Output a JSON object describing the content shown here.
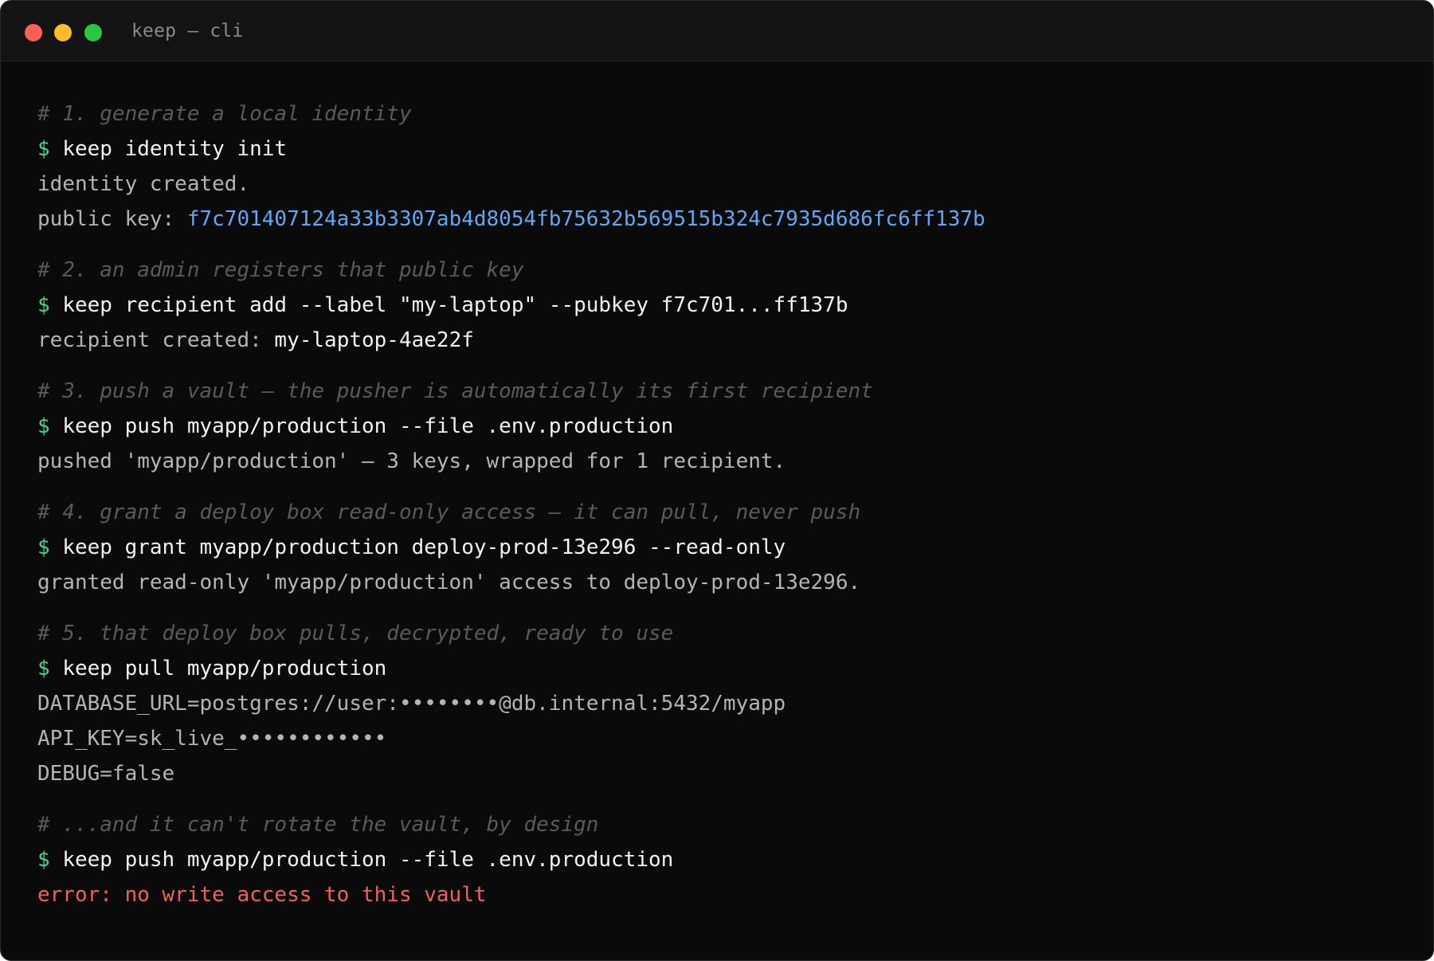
{
  "window": {
    "title": "keep — cli",
    "colors": {
      "close": "#ff5f57",
      "minimize": "#febc2e",
      "zoom": "#28c840"
    }
  },
  "colors": {
    "background": "#0a0a0a",
    "prompt": "#3ddc84",
    "command": "#f2f2f2",
    "output": "#b4b4b4",
    "comment": "#5a5a5a",
    "key": "#5fa8f5",
    "error": "#f25f5f"
  },
  "terminal": {
    "prompt_symbol": "$",
    "step1": {
      "comment": "# 1. generate a local identity",
      "command": "keep identity init",
      "output1": "identity created.",
      "output2_label": "public key: ",
      "output2_value": "f7c701407124a33b3307ab4d8054fb75632b569515b324c7935d686fc6ff137b"
    },
    "step2": {
      "comment": "# 2. an admin registers that public key",
      "command": "keep recipient add --label \"my-laptop\" --pubkey f7c701...ff137b",
      "output_label": "recipient created: ",
      "output_value": "my-laptop-4ae22f"
    },
    "step3": {
      "comment": "# 3. push a vault — the pusher is automatically its first recipient",
      "command": "keep push myapp/production --file .env.production",
      "output": "pushed 'myapp/production' — 3 keys, wrapped for 1 recipient."
    },
    "step4": {
      "comment": "# 4. grant a deploy box read-only access — it can pull, never push",
      "command": "keep grant myapp/production deploy-prod-13e296 --read-only",
      "output": "granted read-only 'myapp/production' access to deploy-prod-13e296."
    },
    "step5": {
      "comment": "# 5. that deploy box pulls, decrypted, ready to use",
      "command": "keep pull myapp/production",
      "output1": "DATABASE_URL=postgres://user:••••••••@db.internal:5432/myapp",
      "output2": "API_KEY=sk_live_••••••••••••",
      "output3": "DEBUG=false"
    },
    "step6": {
      "comment": "# ...and it can't rotate the vault, by design",
      "command": "keep push myapp/production --file .env.production",
      "error": "error: no write access to this vault"
    }
  }
}
